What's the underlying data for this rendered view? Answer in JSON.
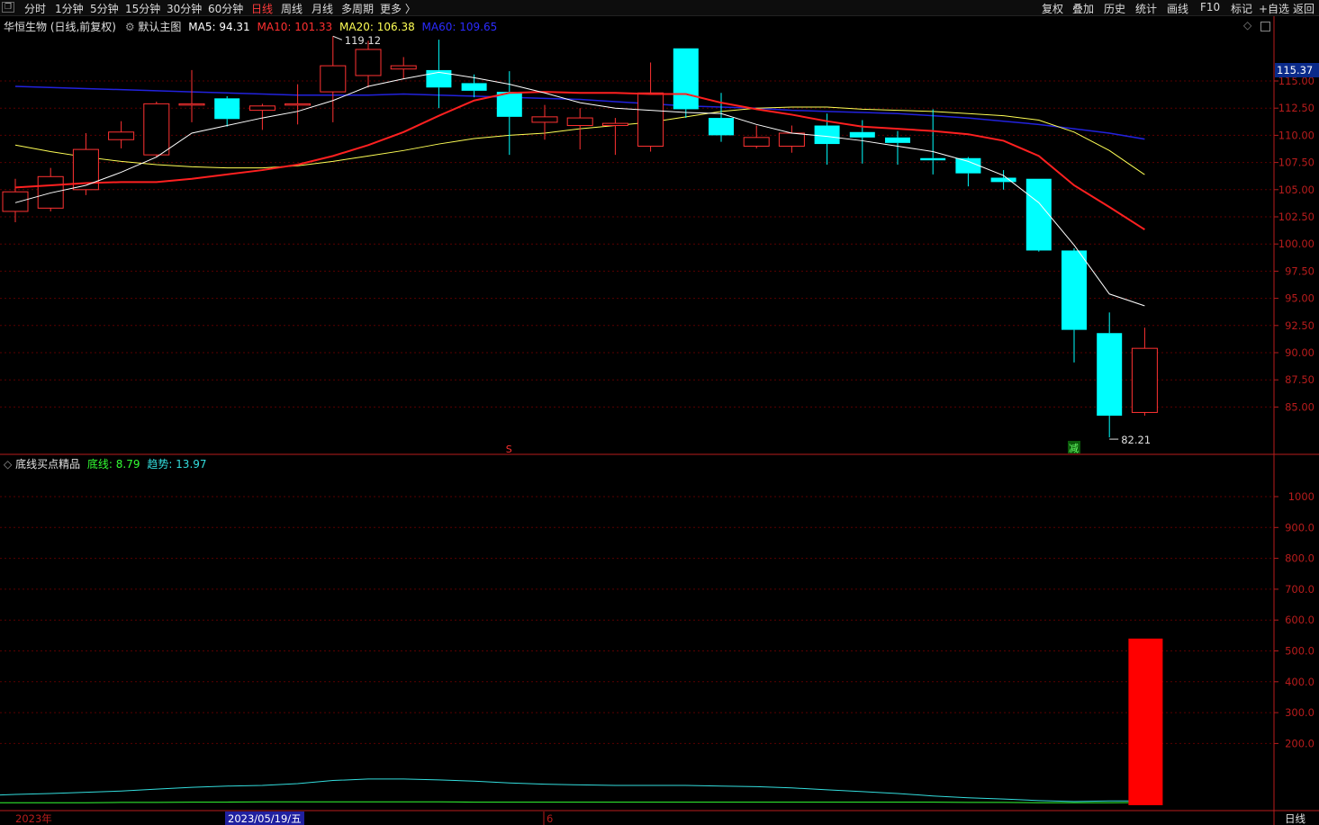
{
  "toolbar": {
    "periods": [
      "分时",
      "1分钟",
      "5分钟",
      "15分钟",
      "30分钟",
      "60分钟",
      "日线",
      "周线",
      "月线",
      "多周期",
      "更多 〉"
    ],
    "active_period": "日线",
    "right_buttons": [
      "复权",
      "叠加",
      "历史",
      "统计",
      "画线",
      "F10",
      "标记",
      "+自选",
      "返回"
    ]
  },
  "main_legend": {
    "stock": "华恒生物 (日线,前复权)",
    "template": "默认主图",
    "ma5": "MA5: 94.31",
    "ma10": "MA10: 101.33",
    "ma20": "MA20: 106.38",
    "ma60": "MA60: 109.65"
  },
  "sub_legend": {
    "name": "底线买点精品",
    "line1": "底线: 8.79",
    "line2": "趋势: 13.97"
  },
  "colors": {
    "up": "#ff3232",
    "down": "#00ffff",
    "ma5": "#ffffff",
    "ma10": "#ff2020",
    "ma20": "#ffff55",
    "ma60": "#2222dd",
    "axis": "#b81c1c",
    "grid": "#5a0000"
  },
  "price_axis": {
    "ticks": [
      "115.00",
      "112.50",
      "110.00",
      "107.50",
      "105.00",
      "102.50",
      "100.00",
      "97.50",
      "95.00",
      "92.50",
      "90.00",
      "87.50",
      "85.00"
    ],
    "current": "115.37"
  },
  "sub_axis": {
    "ticks": [
      "1000",
      "900.0",
      "800.0",
      "700.0",
      "600.0",
      "500.0",
      "400.0",
      "300.0",
      "200.0"
    ]
  },
  "annotations": {
    "high": "119.12",
    "low": "82.21",
    "marker_s": "S",
    "marker_jian": "减"
  },
  "date_axis": {
    "year": "2023年",
    "cursor_date": "2023/05/19/五",
    "month": "6",
    "period_label": "日线"
  },
  "chart_data": {
    "type": "candlestick",
    "ohlc": [
      {
        "o": 103.0,
        "h": 106.0,
        "l": 102.0,
        "c": 104.8
      },
      {
        "o": 103.3,
        "h": 107.0,
        "l": 103.0,
        "c": 106.2
      },
      {
        "o": 105.0,
        "h": 110.2,
        "l": 104.5,
        "c": 108.7
      },
      {
        "o": 109.6,
        "h": 111.3,
        "l": 108.8,
        "c": 110.3
      },
      {
        "o": 108.2,
        "h": 113.1,
        "l": 108.0,
        "c": 112.9
      },
      {
        "o": 112.8,
        "h": 116.0,
        "l": 111.2,
        "c": 112.9
      },
      {
        "o": 113.4,
        "h": 113.6,
        "l": 110.8,
        "c": 111.5
      },
      {
        "o": 112.3,
        "h": 112.9,
        "l": 110.5,
        "c": 112.7
      },
      {
        "o": 112.8,
        "h": 114.7,
        "l": 111.0,
        "c": 112.9
      },
      {
        "o": 114.0,
        "h": 119.12,
        "l": 111.2,
        "c": 116.4
      },
      {
        "o": 115.5,
        "h": 118.7,
        "l": 114.4,
        "c": 117.9
      },
      {
        "o": 116.1,
        "h": 117.2,
        "l": 115.2,
        "c": 116.4
      },
      {
        "o": 116.0,
        "h": 118.8,
        "l": 112.5,
        "c": 114.4
      },
      {
        "o": 114.8,
        "h": 115.6,
        "l": 113.5,
        "c": 114.1
      },
      {
        "o": 114.0,
        "h": 115.9,
        "l": 108.2,
        "c": 111.7
      },
      {
        "o": 111.2,
        "h": 112.8,
        "l": 109.6,
        "c": 111.7
      },
      {
        "o": 110.9,
        "h": 112.5,
        "l": 108.7,
        "c": 111.6
      },
      {
        "o": 110.9,
        "h": 111.6,
        "l": 108.2,
        "c": 111.1
      },
      {
        "o": 109.0,
        "h": 116.7,
        "l": 108.5,
        "c": 113.9
      },
      {
        "o": 118.0,
        "h": 118.0,
        "l": 111.6,
        "c": 112.4
      },
      {
        "o": 111.6,
        "h": 113.9,
        "l": 109.4,
        "c": 110.0
      },
      {
        "o": 109.0,
        "h": 110.9,
        "l": 108.8,
        "c": 109.8
      },
      {
        "o": 109.0,
        "h": 110.9,
        "l": 108.4,
        "c": 110.2
      },
      {
        "o": 110.9,
        "h": 112.0,
        "l": 107.3,
        "c": 109.2
      },
      {
        "o": 110.3,
        "h": 111.4,
        "l": 107.4,
        "c": 109.8
      },
      {
        "o": 109.8,
        "h": 110.4,
        "l": 107.3,
        "c": 109.3
      },
      {
        "o": 107.9,
        "h": 112.4,
        "l": 106.4,
        "c": 107.7
      },
      {
        "o": 107.9,
        "h": 108.0,
        "l": 105.3,
        "c": 106.5
      },
      {
        "o": 106.1,
        "h": 106.8,
        "l": 105.0,
        "c": 105.7
      },
      {
        "o": 106.0,
        "h": 106.0,
        "l": 99.3,
        "c": 99.4
      },
      {
        "o": 99.4,
        "h": 99.6,
        "l": 89.1,
        "c": 92.1
      },
      {
        "o": 91.8,
        "h": 93.7,
        "l": 82.21,
        "c": 84.2
      },
      {
        "o": 84.5,
        "h": 92.3,
        "l": 84.2,
        "c": 90.4
      }
    ],
    "ma5": [
      103.8,
      104.7,
      105.4,
      106.6,
      108.0,
      110.2,
      110.9,
      111.6,
      112.2,
      113.2,
      114.5,
      115.2,
      115.8,
      115.3,
      114.7,
      113.9,
      113.0,
      112.5,
      112.3,
      112.1,
      112.0,
      111.0,
      110.2,
      109.9,
      109.5,
      109.0,
      108.5,
      107.6,
      106.3,
      103.8,
      99.9,
      95.4,
      94.31
    ],
    "ma10": [
      105.2,
      105.4,
      105.6,
      105.7,
      105.7,
      106.0,
      106.4,
      106.8,
      107.3,
      108.1,
      109.1,
      110.3,
      111.8,
      113.2,
      113.9,
      114.0,
      113.9,
      113.9,
      113.8,
      113.8,
      113.0,
      112.4,
      111.9,
      111.3,
      110.8,
      110.6,
      110.4,
      110.1,
      109.5,
      108.1,
      105.4,
      103.4,
      101.33
    ],
    "ma20": [
      109.1,
      108.5,
      108.0,
      107.6,
      107.3,
      107.1,
      107.0,
      107.0,
      107.2,
      107.6,
      108.1,
      108.6,
      109.2,
      109.7,
      110.0,
      110.2,
      110.6,
      110.9,
      111.2,
      111.7,
      112.2,
      112.5,
      112.6,
      112.6,
      112.4,
      112.3,
      112.2,
      112.0,
      111.8,
      111.4,
      110.3,
      108.6,
      106.38
    ],
    "ma60": [
      114.5,
      114.4,
      114.3,
      114.2,
      114.1,
      114.0,
      113.9,
      113.8,
      113.7,
      113.7,
      113.7,
      113.8,
      113.7,
      113.6,
      113.5,
      113.4,
      113.3,
      113.1,
      112.9,
      112.7,
      112.6,
      112.5,
      112.3,
      112.2,
      112.1,
      112.0,
      111.8,
      111.6,
      111.3,
      111.0,
      110.6,
      110.2,
      109.65
    ],
    "sub": {
      "bar_index": 32,
      "bar_value": 540,
      "line1": [
        8,
        8,
        8,
        9,
        9,
        10,
        10,
        11,
        11,
        11,
        11,
        11,
        11,
        10,
        10,
        10,
        10,
        10,
        10,
        10,
        10,
        10,
        10,
        10,
        10,
        10,
        10,
        9,
        9,
        8,
        8,
        8,
        8.79
      ],
      "line2": [
        35,
        38,
        42,
        46,
        52,
        58,
        62,
        64,
        70,
        80,
        85,
        85,
        82,
        78,
        72,
        68,
        66,
        64,
        64,
        64,
        62,
        60,
        56,
        50,
        44,
        38,
        30,
        24,
        20,
        15,
        12,
        14,
        13.97
      ]
    }
  }
}
